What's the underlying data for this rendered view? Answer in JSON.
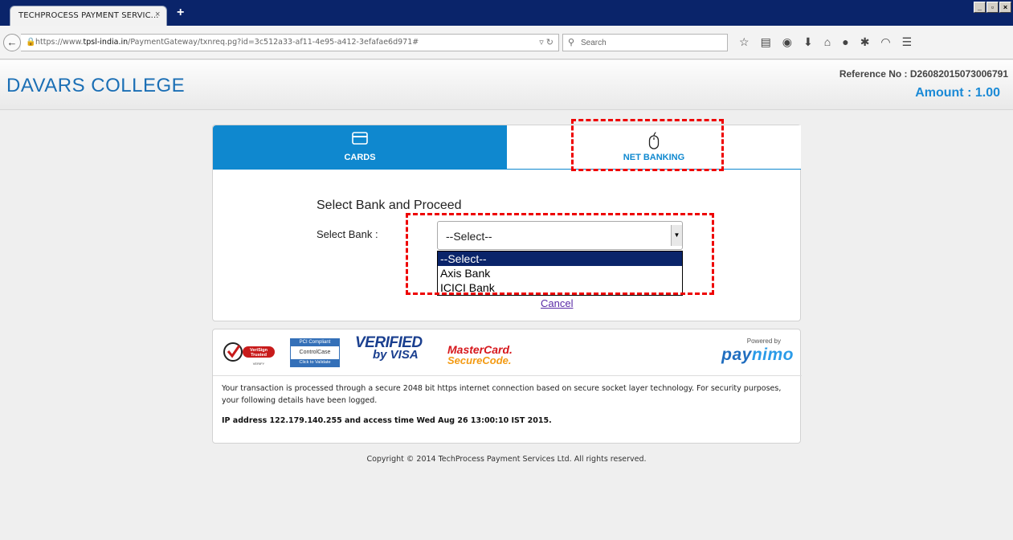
{
  "browser": {
    "tab_title": "TECHPROCESS PAYMENT SERVIC...",
    "tab_close": "×",
    "new_tab": "+",
    "window_buttons": [
      "_",
      "▫",
      "×"
    ],
    "url_prefix": "https://www.",
    "url_domain": "tpsl-india.in",
    "url_rest": "/PaymentGateway/txnreq.pg?id=3c512a33-af11-4e95-a412-3efafae6d971#",
    "search_placeholder": "Search"
  },
  "header": {
    "college_name": "DAVARS COLLEGE",
    "reference": "Reference No : D26082015073006791",
    "amount": "Amount : 1.00"
  },
  "payment": {
    "tabs": [
      {
        "label": "CARDS",
        "active": true
      },
      {
        "label": "NET BANKING",
        "active": false
      }
    ],
    "heading": "Select Bank and Proceed",
    "select_label": "Select Bank :",
    "select_value": "--Select--",
    "options": [
      "--Select--",
      "Axis Bank",
      "ICICI Bank"
    ],
    "cancel": "Cancel"
  },
  "security": {
    "verisign": "VeriSign Trusted",
    "verisign_sub": "VERIFY",
    "pci_top": "PCI Compliant",
    "pci_mid": "ControlCase",
    "pci_bottom": "Click to Validate",
    "visa_line1": "VERIFIED",
    "visa_line2": "by VISA",
    "mc_line1": "MasterCard.",
    "mc_line2": "SecureCode.",
    "powered_by": "Powered by",
    "paynimo_a": "pay",
    "paynimo_b": "nimo",
    "notice": "Your transaction is processed through a secure 2048 bit https internet connection based on secure socket layer technology. For security purposes, your following details have been logged.",
    "ip_line": "IP address 122.179.140.255 and access time Wed Aug 26 13:00:10 IST 2015."
  },
  "footer": {
    "copyright": "Copyright © 2014 TechProcess Payment Services Ltd. All rights reserved."
  },
  "colors": {
    "brand_blue": "#0f88cf",
    "annotation_red": "#e00000",
    "title_bar": "#0a246a"
  }
}
